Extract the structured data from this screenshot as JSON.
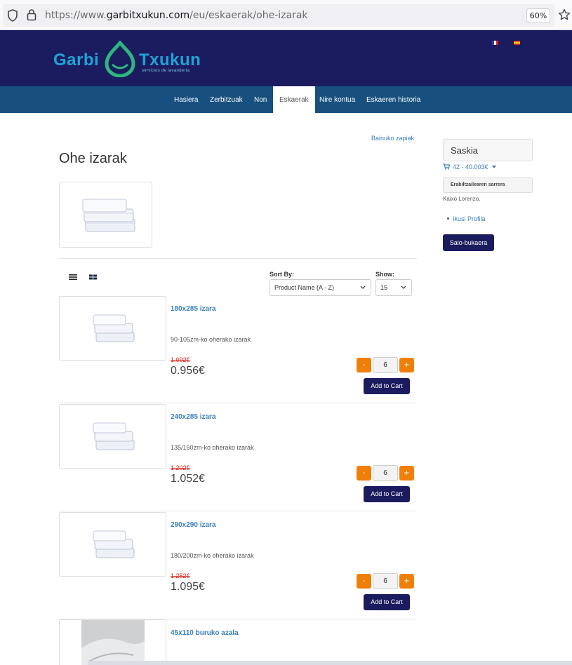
{
  "browser": {
    "url_prefix": "https://www.",
    "url_domain": "garbitxukun.com",
    "url_path": "/eu/eskaerak/ohe-izarak",
    "zoom": "60%"
  },
  "header": {
    "logo_left": "Garbi",
    "logo_right": "Txukun",
    "logo_tagline": "servicios de lavandería"
  },
  "nav": {
    "items": [
      "Hasiera",
      "Zerbitzuak",
      "Non",
      "Eskaerak",
      "Nire kontua",
      "Eskaeren historia"
    ],
    "active": "Eskaerak"
  },
  "main": {
    "breadcrumb_link": "Bainuko zapiak",
    "title": "Ohe izarak",
    "sort_label": "Sort By:",
    "sort_value": "Product Name (A - Z)",
    "show_label": "Show:",
    "show_value": "15"
  },
  "products": [
    {
      "name": "180x285 izara",
      "description": "90-105zm-ko oherako izarak",
      "old_price": "1.092€",
      "price": "0.956€",
      "qty": "6",
      "minus": "-",
      "plus": "+",
      "add_label": "Add to Cart"
    },
    {
      "name": "240x285 izara",
      "description": "135/150zm-ko oherako izarak",
      "old_price": "1.202€",
      "price": "1.052€",
      "qty": "6",
      "minus": "-",
      "plus": "+",
      "add_label": "Add to Cart"
    },
    {
      "name": "290x290 izara",
      "description": "180/200zm-ko oherako izarak",
      "old_price": "1.252€",
      "price": "1.095€",
      "qty": "6",
      "minus": "-",
      "plus": "+",
      "add_label": "Add to Cart"
    },
    {
      "name": "45x110 buruko azala"
    }
  ],
  "sidebar": {
    "cart_title": "Saskia",
    "cart_summary": "42 - 40.003€",
    "user_box": "Erabiltzailearen sarrera",
    "greeting": "Kaixo Lorenzo,",
    "profile_link": "Ikusi Profila",
    "logout": "Saio-bukaera"
  },
  "colors": {
    "header_bg": "#1b1c5f",
    "nav_bg": "#17507f",
    "accent_orange": "#f07f09",
    "link_blue": "#3a7fb8",
    "old_price_red": "#d9241c"
  }
}
